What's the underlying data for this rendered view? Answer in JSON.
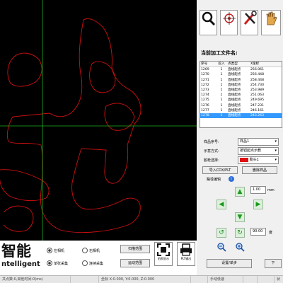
{
  "toolbar": {
    "buttons": [
      {
        "label": "",
        "icon": "search-icon"
      },
      {
        "label": "",
        "icon": "target-icon"
      },
      {
        "label": "",
        "icon": "tools-icon"
      },
      {
        "label": "",
        "icon": "hand-icon"
      }
    ]
  },
  "current_file": {
    "title": "当前加工文件名:",
    "name": ""
  },
  "table": {
    "columns": [
      "序号",
      "段入",
      "点类型",
      "X坐标"
    ],
    "rows": [
      [
        "1269",
        "1",
        "直线起点",
        "256.061"
      ],
      [
        "1270",
        "1",
        "直线起点",
        "256.448"
      ],
      [
        "1271",
        "1",
        "直线起点",
        "258.448"
      ],
      [
        "1272",
        "1",
        "直线起点",
        "254.730"
      ],
      [
        "1273",
        "1",
        "直线起点",
        "253.989"
      ],
      [
        "1274",
        "1",
        "直线起点",
        "251.063"
      ],
      [
        "1275",
        "1",
        "直线起点",
        "249.695"
      ],
      [
        "1276",
        "1",
        "直线起点",
        "247.231"
      ],
      [
        "1277",
        "1",
        "直线起点",
        "246.161"
      ],
      [
        "1278",
        "1",
        "直线起点",
        "243.263"
      ]
    ],
    "selected_index": 9
  },
  "settings": {
    "sample_label": "样品序号:",
    "sample_value": "样品1",
    "display_label": "示意方式:",
    "display_value": "按钮起点示教",
    "color_label": "胶枪选择:",
    "color_value": "胶头1",
    "color_swatch": "#e01010"
  },
  "tabs": [
    "导入CDX/PLT",
    "删除样品"
  ],
  "path": {
    "title": "路径编辑",
    "step_value": "1.00",
    "step_unit": "mm",
    "angle_value": "90.00",
    "angle_unit": "度"
  },
  "bottom": {
    "logo_text": "智能",
    "logo_sub": "ntelligent",
    "radios": [
      "左相机",
      "右相机",
      "单张采集",
      "连续采集"
    ],
    "radio_selected": [
      0,
      2
    ],
    "scan_buttons": [
      "扫描范围",
      "运动范围"
    ],
    "icon_buttons": [
      {
        "label": "拍照显示",
        "icon": "capture-frame-icon"
      },
      {
        "label": "PLT输出",
        "icon": "printer-icon"
      }
    ]
  },
  "actions": {
    "set_button": "设置/单步",
    "next_button": "下"
  },
  "status": {
    "items": [
      "共点数:0,其他时间:0(ms)",
      "",
      "坐标 X:0.000, Y:0.000, Z:0.000",
      "",
      "手动低速",
      "",
      "",
      "状"
    ]
  },
  "colors": {
    "canvas_bg": "#000000",
    "outline": "#d01010",
    "crosshair": "#20b020",
    "selection": "#3399ff"
  }
}
